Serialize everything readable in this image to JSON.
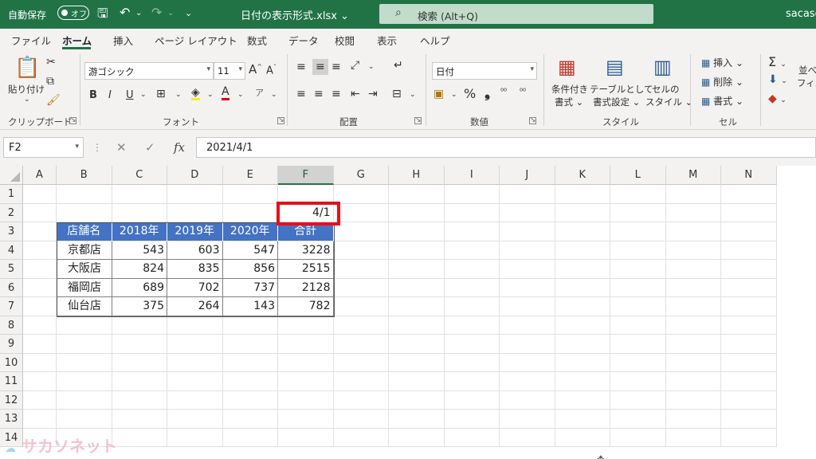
{
  "titlebar": {
    "autosave_label": "自動保存",
    "autosave_state": "オフ",
    "filename": "日付の表示形式.xlsx",
    "search_placeholder": "検索 (Alt+Q)",
    "user": "sacaso"
  },
  "menu": {
    "tabs": [
      "ファイル",
      "ホーム",
      "挿入",
      "ページ レイアウト",
      "数式",
      "データ",
      "校閲",
      "表示",
      "ヘルプ"
    ],
    "active": "ホーム"
  },
  "ribbon": {
    "clipboard": {
      "paste_label": "貼り付け",
      "group_label": "クリップボード"
    },
    "font": {
      "font_name": "游ゴシック",
      "font_size": "11",
      "bold": "B",
      "italic": "I",
      "underline": "U",
      "group_label": "フォント"
    },
    "alignment": {
      "group_label": "配置"
    },
    "number": {
      "format": "日付",
      "group_label": "数値"
    },
    "styles": {
      "conditional_label_1": "条件付き",
      "conditional_label_2": "書式",
      "table_label_1": "テーブルとして",
      "table_label_2": "書式設定",
      "cell_style_label_1": "セルの",
      "cell_style_label_2": "スタイル",
      "group_label": "スタイル"
    },
    "cells": {
      "insert_label": "挿入",
      "delete_label": "削除",
      "format_label": "書式",
      "group_label": "セル"
    },
    "editing": {
      "sort_label_1": "並べ",
      "sort_label_2": "フィル"
    }
  },
  "formula_bar": {
    "name_box": "F2",
    "formula": "2021/4/1"
  },
  "grid": {
    "columns": [
      "A",
      "B",
      "C",
      "D",
      "E",
      "F",
      "G",
      "H",
      "I",
      "J",
      "K",
      "L",
      "M",
      "N"
    ],
    "selected_column": "F",
    "rows": [
      "1",
      "2",
      "3",
      "4",
      "5",
      "6",
      "7",
      "8",
      "9",
      "10",
      "11",
      "12",
      "13",
      "14"
    ],
    "f2_value": "4/1",
    "table": {
      "headers": [
        "店舗名",
        "2018年",
        "2019年",
        "2020年",
        "合計"
      ],
      "rows": [
        [
          "京都店",
          "543",
          "603",
          "547",
          "3228"
        ],
        [
          "大阪店",
          "824",
          "835",
          "856",
          "2515"
        ],
        [
          "福岡店",
          "689",
          "702",
          "737",
          "2128"
        ],
        [
          "仙台店",
          "375",
          "264",
          "143",
          "782"
        ]
      ]
    }
  },
  "watermark": "サカソネット",
  "colors": {
    "excel_green": "#217346",
    "table_header": "#4472c4",
    "highlight": "#e5101c"
  }
}
